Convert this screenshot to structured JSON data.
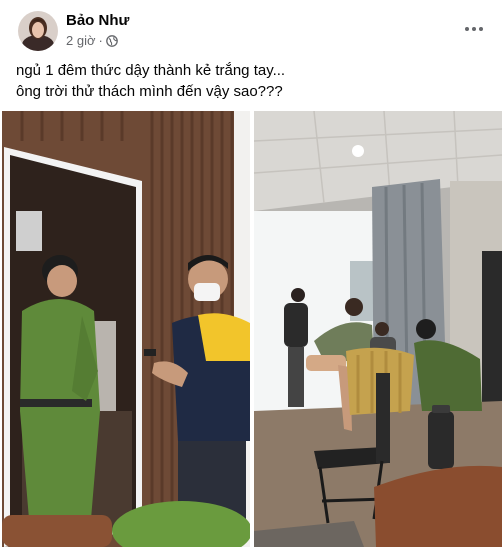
{
  "post": {
    "author": "Bảo Như",
    "time": "2 giờ",
    "time_separator": "·",
    "privacy_icon": "globe-icon",
    "more_icon": "more-options-icon",
    "caption_lines": [
      "ngủ 1 đêm thức dậy thành kẻ trắng tay...",
      "ông trời thử thách mình đến vậy sao???"
    ]
  },
  "photos": [
    {
      "name": "photo-doorway-officers"
    },
    {
      "name": "photo-living-room"
    }
  ]
}
